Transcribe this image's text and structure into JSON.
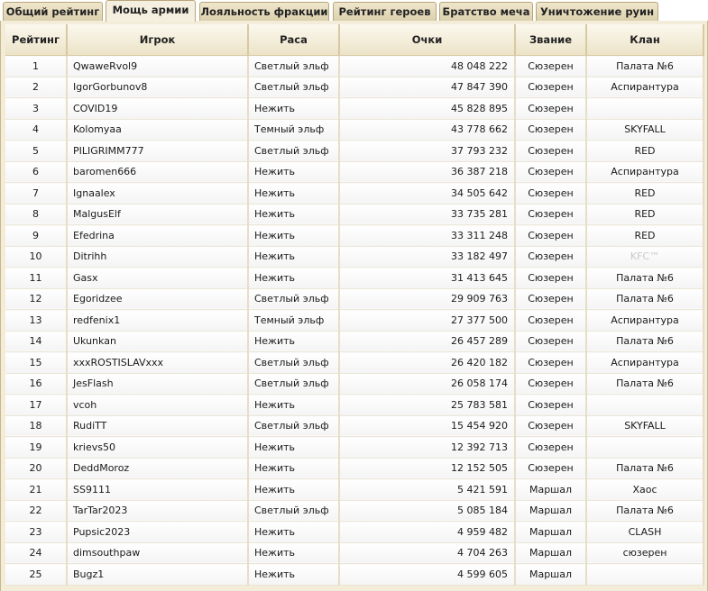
{
  "tabs": [
    {
      "label": "Общий рейтинг"
    },
    {
      "label": "Мощь армии"
    },
    {
      "label": "Лояльность фракции"
    },
    {
      "label": "Рейтинг героев"
    },
    {
      "label": "Братство меча"
    },
    {
      "label": "Уничтожение руин"
    }
  ],
  "active_tab": "Мощь армии",
  "table": {
    "headers": {
      "rank": "Рейтинг",
      "player": "Игрок",
      "race": "Раса",
      "points": "Очки",
      "title": "Звание",
      "clan": "Клан"
    },
    "rows": [
      {
        "rank": "1",
        "player": "QwaweRvol9",
        "race": "Светлый эльф",
        "points": "48 048 222",
        "title": "Сюзерен",
        "clan": "Палата №6"
      },
      {
        "rank": "2",
        "player": "IgorGorbunov8",
        "race": "Светлый эльф",
        "points": "47 847 390",
        "title": "Сюзерен",
        "clan": "Аспирантура"
      },
      {
        "rank": "3",
        "player": "COVID19",
        "race": "Нежить",
        "points": "45 828 895",
        "title": "Сюзерен",
        "clan": ""
      },
      {
        "rank": "4",
        "player": "Kolomyaa",
        "race": "Темный эльф",
        "points": "43 778 662",
        "title": "Сюзерен",
        "clan": "SKYFALL"
      },
      {
        "rank": "5",
        "player": "PILIGRIMM777",
        "race": "Светлый эльф",
        "points": "37 793 232",
        "title": "Сюзерен",
        "clan": "RED"
      },
      {
        "rank": "6",
        "player": "baromen666",
        "race": "Нежить",
        "points": "36 387 218",
        "title": "Сюзерен",
        "clan": "Аспирантура"
      },
      {
        "rank": "7",
        "player": "Ignaalex",
        "race": "Нежить",
        "points": "34 505 642",
        "title": "Сюзерен",
        "clan": "RED"
      },
      {
        "rank": "8",
        "player": "MalgusElf",
        "race": "Нежить",
        "points": "33 735 281",
        "title": "Сюзерен",
        "clan": "RED"
      },
      {
        "rank": "9",
        "player": "Efedrina",
        "race": "Нежить",
        "points": "33 311 248",
        "title": "Сюзерен",
        "clan": "RED"
      },
      {
        "rank": "10",
        "player": "Ditrihh",
        "race": "Нежить",
        "points": "33 182 497",
        "title": "Сюзерен",
        "clan": "KFC™",
        "clan_faded": true
      },
      {
        "rank": "11",
        "player": "Gasx",
        "race": "Нежить",
        "points": "31 413 645",
        "title": "Сюзерен",
        "clan": "Палата №6"
      },
      {
        "rank": "12",
        "player": "Egoridzee",
        "race": "Светлый эльф",
        "points": "29 909 763",
        "title": "Сюзерен",
        "clan": "Палата №6"
      },
      {
        "rank": "13",
        "player": "redfenix1",
        "race": "Темный эльф",
        "points": "27 377 500",
        "title": "Сюзерен",
        "clan": "Аспирантура"
      },
      {
        "rank": "14",
        "player": "Ukunkan",
        "race": "Нежить",
        "points": "26 457 289",
        "title": "Сюзерен",
        "clan": "Палата №6"
      },
      {
        "rank": "15",
        "player": "xxxROSTISLAVxxx",
        "race": "Светлый эльф",
        "points": "26 420 182",
        "title": "Сюзерен",
        "clan": "Аспирантура"
      },
      {
        "rank": "16",
        "player": "JesFlash",
        "race": "Светлый эльф",
        "points": "26 058 174",
        "title": "Сюзерен",
        "clan": "Палата №6"
      },
      {
        "rank": "17",
        "player": "vcoh",
        "race": "Нежить",
        "points": "25 783 581",
        "title": "Сюзерен",
        "clan": ""
      },
      {
        "rank": "18",
        "player": "RudiTT",
        "race": "Светлый эльф",
        "points": "15 454 920",
        "title": "Сюзерен",
        "clan": "SKYFALL"
      },
      {
        "rank": "19",
        "player": "krievs50",
        "race": "Нежить",
        "points": "12 392 713",
        "title": "Сюзерен",
        "clan": ""
      },
      {
        "rank": "20",
        "player": "DeddMoroz",
        "race": "Нежить",
        "points": "12 152 505",
        "title": "Сюзерен",
        "clan": "Палата №6"
      },
      {
        "rank": "21",
        "player": "SS9111",
        "race": "Нежить",
        "points": "5 421 591",
        "title": "Маршал",
        "clan": "Хаос"
      },
      {
        "rank": "22",
        "player": "TarTar2023",
        "race": "Светлый эльф",
        "points": "5 085 184",
        "title": "Маршал",
        "clan": "Палата №6"
      },
      {
        "rank": "23",
        "player": "Pupsic2023",
        "race": "Нежить",
        "points": "4 959 482",
        "title": "Маршал",
        "clan": "CLASH"
      },
      {
        "rank": "24",
        "player": "dimsouthpaw",
        "race": "Нежить",
        "points": "4 704 263",
        "title": "Маршал",
        "clan": "сюзерен"
      },
      {
        "rank": "25",
        "player": "Bugz1",
        "race": "Нежить",
        "points": "4 599 605",
        "title": "Маршал",
        "clan": ""
      }
    ]
  }
}
